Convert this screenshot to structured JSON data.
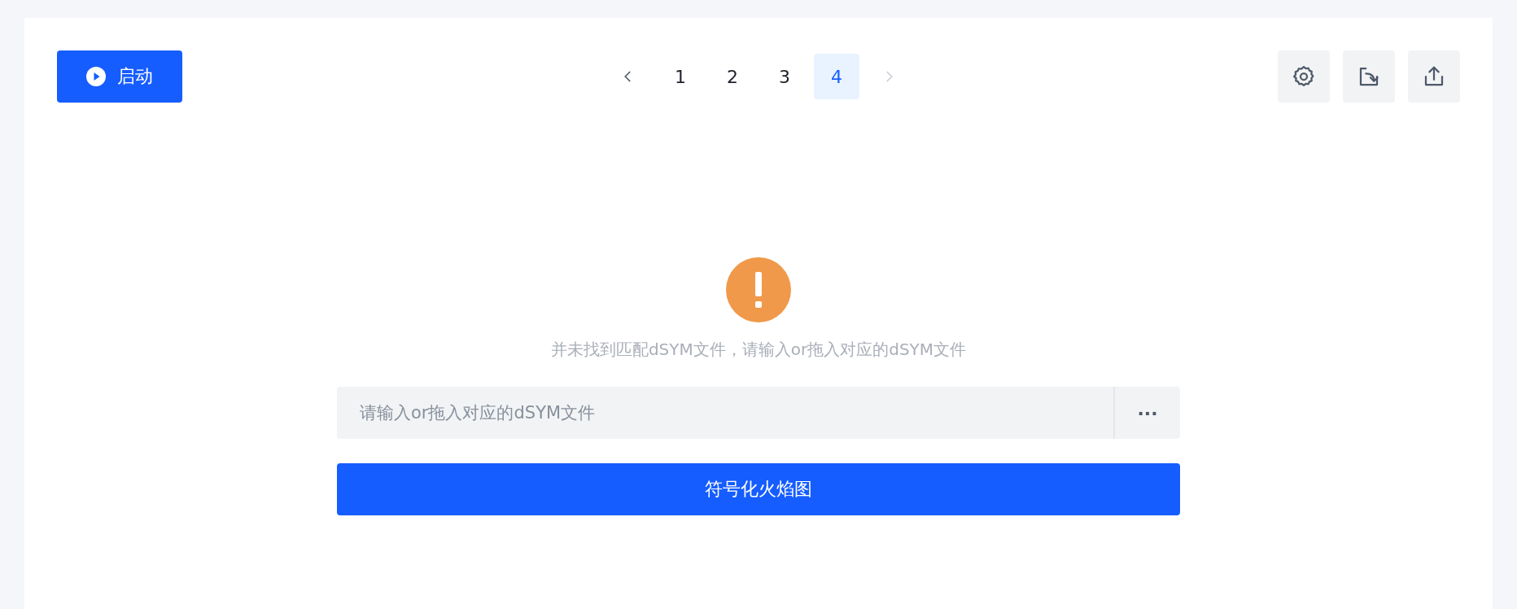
{
  "toolbar": {
    "start_button": {
      "label": "启动"
    },
    "pagination": {
      "prev": {
        "disabled": false
      },
      "pages": [
        {
          "label": "1",
          "selected": false
        },
        {
          "label": "2",
          "selected": false
        },
        {
          "label": "3",
          "selected": false
        },
        {
          "label": "4",
          "selected": true
        }
      ],
      "next": {
        "disabled": true
      }
    },
    "actions": [
      {
        "kind": "settings"
      },
      {
        "kind": "import"
      },
      {
        "kind": "export"
      }
    ]
  },
  "empty_state": {
    "message": "并未找到匹配dSYM文件，请输入or拖入对应的dSYM文件",
    "file_field": {
      "placeholder": "请输入or拖入对应的dSYM文件",
      "browse_label": "···"
    },
    "submit_button": {
      "label": "符号化火焰图"
    }
  }
}
